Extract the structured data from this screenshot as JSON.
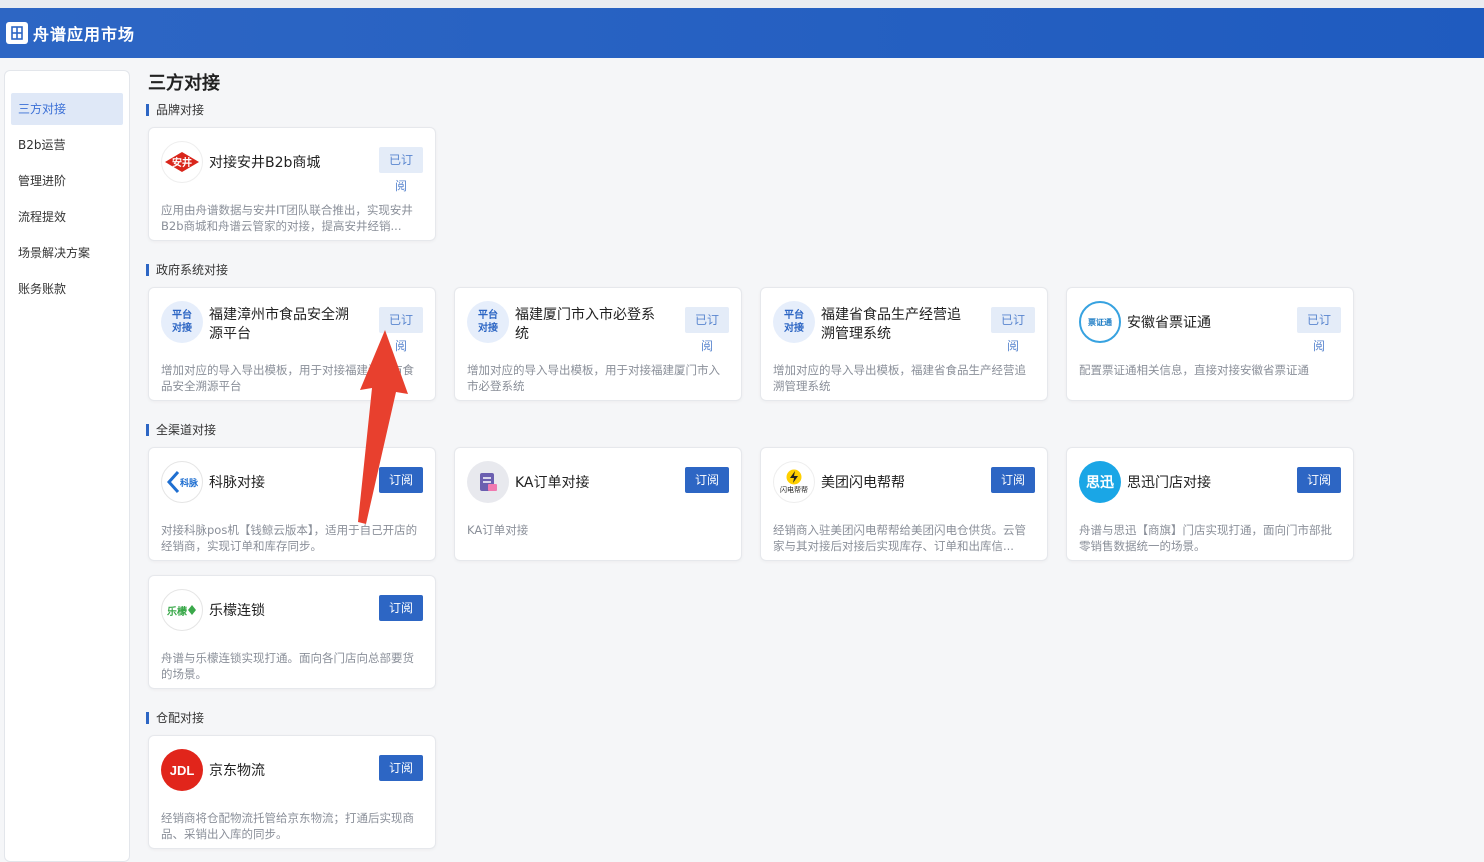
{
  "app": {
    "title": "舟谱应用市场"
  },
  "sidebar": {
    "items": [
      {
        "label": "三方对接",
        "active": true
      },
      {
        "label": "B2b运营",
        "active": false
      },
      {
        "label": "管理进阶",
        "active": false
      },
      {
        "label": "流程提效",
        "active": false
      },
      {
        "label": "场景解决方案",
        "active": false
      },
      {
        "label": "账务账款",
        "active": false
      }
    ]
  },
  "page": {
    "title": "三方对接"
  },
  "sections": [
    {
      "title": "品牌对接",
      "cards": [
        {
          "name": "对接安井B2b商城",
          "button": "已订阅",
          "icon": "anjing-logo-icon",
          "icon_text": "安井",
          "desc": "应用由舟谱数据与安井IT团队联合推出，实现安井B2b商城和舟谱云管家的对接，提高安井经销..."
        }
      ]
    },
    {
      "title": "政府系统对接",
      "cards": [
        {
          "name": "福建漳州市食品安全溯源平台",
          "button": "已订阅",
          "icon": "platform-icon",
          "icon_text": "平台对接",
          "desc": "增加对应的导入导出模板，用于对接福建漳州市食品安全溯源平台"
        },
        {
          "name": "福建厦门市入市必登系统",
          "button": "已订阅",
          "icon": "platform-icon",
          "icon_text": "平台对接",
          "desc": "增加对应的导入导出模板，用于对接福建厦门市入市必登系统"
        },
        {
          "name": "福建省食品生产经营追溯管理系统",
          "button": "已订阅",
          "icon": "platform-icon",
          "icon_text": "平台对接",
          "desc": "增加对应的导入导出模板，福建省食品生产经营追溯管理系统"
        },
        {
          "name": "安徽省票证通",
          "button": "已订阅",
          "icon": "piaozhengtong-logo-icon",
          "icon_text": "票证通",
          "desc": "配置票证通相关信息，直接对接安徽省票证通"
        }
      ]
    },
    {
      "title": "全渠道对接",
      "cards": [
        {
          "name": "科脉对接",
          "button": "订阅",
          "icon": "kemai-logo-icon",
          "icon_text": "科脉",
          "desc": "对接科脉pos机【钱鲸云版本】，适用于自己开店的经销商，实现订单和库存同步。"
        },
        {
          "name": "KA订单对接",
          "button": "订阅",
          "icon": "ka-order-icon",
          "icon_text": "",
          "desc": "KA订单对接"
        },
        {
          "name": "美团闪电帮帮",
          "button": "订阅",
          "icon": "meituan-lightning-icon",
          "icon_text": "闪电帮帮",
          "desc": "经销商入驻美团闪电帮帮给美团闪电仓供货。云管家与其对接后对接后实现库存、订单和出库信..."
        },
        {
          "name": "思迅门店对接",
          "button": "订阅",
          "icon": "sixun-logo-icon",
          "icon_text": "思迅",
          "desc": "舟谱与思迅【商旗】门店实现打通，面向门市部批零销售数据统一的场景。"
        },
        {
          "name": "乐檬连锁",
          "button": "订阅",
          "icon": "lemon-logo-icon",
          "icon_text": "乐檬",
          "desc": "舟谱与乐檬连锁实现打通。面向各门店向总部要货的场景。"
        }
      ]
    },
    {
      "title": "仓配对接",
      "cards": [
        {
          "name": "京东物流",
          "button": "订阅",
          "icon": "jd-logistics-icon",
          "icon_text": "JDL",
          "desc": "经销商将仓配物流托管给京东物流；打通后实现商品、采销出入库的同步。"
        }
      ]
    }
  ],
  "colors": {
    "primary": "#2d66c4",
    "subscribed_bg": "#e4ecf8",
    "arrow": "#e8402e"
  }
}
